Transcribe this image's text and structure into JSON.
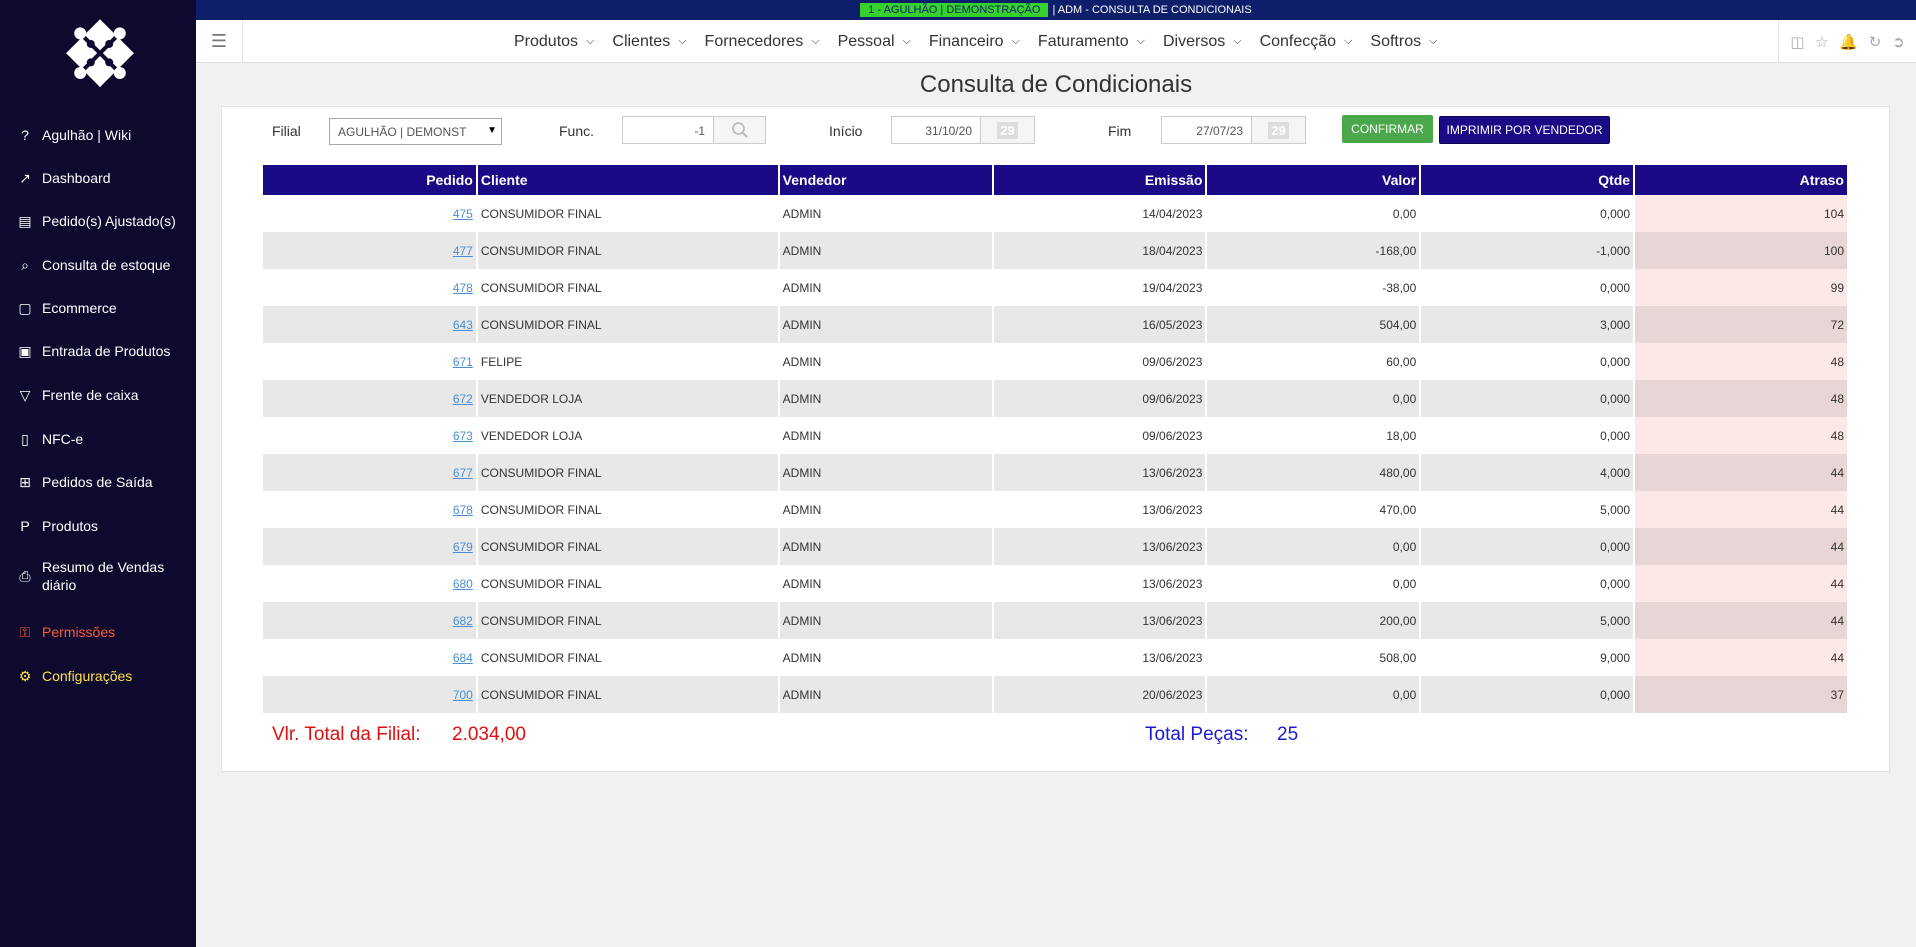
{
  "sidebar": {
    "items": [
      {
        "label": "Agulhão | Wiki",
        "icon": "help-circle-icon"
      },
      {
        "label": "Dashboard",
        "icon": "line-chart-icon"
      },
      {
        "label": "Pedido(s) Ajustado(s)",
        "icon": "clipboard-icon"
      },
      {
        "label": "Consulta de estoque",
        "icon": "search-icon"
      },
      {
        "label": "Ecommerce",
        "icon": "folder-open-icon"
      },
      {
        "label": "Entrada de Produtos",
        "icon": "dolly-icon"
      },
      {
        "label": "Frente de caixa",
        "icon": "basket-icon"
      },
      {
        "label": "NFC-e",
        "icon": "document-icon"
      },
      {
        "label": "Pedidos de Saída",
        "icon": "cart-icon"
      },
      {
        "label": "Produtos",
        "icon": "product-p-icon"
      },
      {
        "label": "Resumo de Vendas diário",
        "icon": "printer-icon"
      },
      {
        "label": "Permissões",
        "icon": "key-icon",
        "color": "#ff5a3c"
      },
      {
        "label": "Configurações",
        "icon": "gears-icon",
        "color": "#ffe14d"
      }
    ]
  },
  "statusbar": {
    "company_tag": "1 - AGULHÃO | DEMONSTRAÇÃO",
    "text": "| ADM - CONSULTA DE CONDICIONAIS"
  },
  "nav": {
    "menus": [
      "Produtos",
      "Clientes",
      "Fornecedores",
      "Pessoal",
      "Financeiro",
      "Faturamento",
      "Diversos",
      "Confecção",
      "Softros"
    ]
  },
  "page": {
    "title": "Consulta de Condicionais"
  },
  "filters": {
    "filial_label": "Filial",
    "filial_value": "AGULHÃO | DEMONST",
    "func_label": "Func.",
    "func_value": "-1",
    "inicio_label": "Início",
    "inicio_value": "31/10/20",
    "fim_label": "Fim",
    "fim_value": "27/07/23",
    "calendar_day": "29",
    "confirm_label": "CONFIRMAR",
    "print_label": "IMPRIMIR POR VENDEDOR"
  },
  "table": {
    "headers": [
      "Pedido",
      "Cliente",
      "Vendedor",
      "Emissão",
      "Valor",
      "Qtde",
      "Atraso"
    ],
    "rows": [
      [
        "475",
        "CONSUMIDOR FINAL",
        "ADMIN",
        "14/04/2023",
        "0,00",
        "0,000",
        "104"
      ],
      [
        "477",
        "CONSUMIDOR FINAL",
        "ADMIN",
        "18/04/2023",
        "-168,00",
        "-1,000",
        "100"
      ],
      [
        "478",
        "CONSUMIDOR FINAL",
        "ADMIN",
        "19/04/2023",
        "-38,00",
        "0,000",
        "99"
      ],
      [
        "643",
        "CONSUMIDOR FINAL",
        "ADMIN",
        "16/05/2023",
        "504,00",
        "3,000",
        "72"
      ],
      [
        "671",
        "FELIPE",
        "ADMIN",
        "09/06/2023",
        "60,00",
        "0,000",
        "48"
      ],
      [
        "672",
        "VENDEDOR LOJA",
        "ADMIN",
        "09/06/2023",
        "0,00",
        "0,000",
        "48"
      ],
      [
        "673",
        "VENDEDOR LOJA",
        "ADMIN",
        "09/06/2023",
        "18,00",
        "0,000",
        "48"
      ],
      [
        "677",
        "CONSUMIDOR FINAL",
        "ADMIN",
        "13/06/2023",
        "480,00",
        "4,000",
        "44"
      ],
      [
        "678",
        "CONSUMIDOR FINAL",
        "ADMIN",
        "13/06/2023",
        "470,00",
        "5,000",
        "44"
      ],
      [
        "679",
        "CONSUMIDOR FINAL",
        "ADMIN",
        "13/06/2023",
        "0,00",
        "0,000",
        "44"
      ],
      [
        "680",
        "CONSUMIDOR FINAL",
        "ADMIN",
        "13/06/2023",
        "0,00",
        "0,000",
        "44"
      ],
      [
        "682",
        "CONSUMIDOR FINAL",
        "ADMIN",
        "13/06/2023",
        "200,00",
        "5,000",
        "44"
      ],
      [
        "684",
        "CONSUMIDOR FINAL",
        "ADMIN",
        "13/06/2023",
        "508,00",
        "9,000",
        "44"
      ],
      [
        "700",
        "CONSUMIDOR FINAL",
        "ADMIN",
        "20/06/2023",
        "0,00",
        "0,000",
        "37"
      ]
    ]
  },
  "totals": {
    "valor_label": "Vlr. Total da Filial:",
    "valor_value": "2.034,00",
    "pecas_label": "Total Peças:",
    "pecas_value": "25"
  },
  "colors": {
    "sidebar_bg": "#0d0a2e",
    "header_bg": "#1a0a85",
    "confirm_green": "#4aa84a",
    "total_red": "#e01010",
    "total_blue": "#1a1ad0"
  }
}
